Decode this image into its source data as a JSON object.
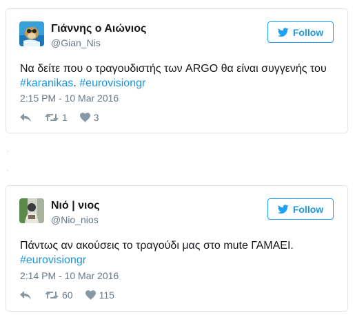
{
  "tweets": [
    {
      "display_name": "Γιάννης ο Αιώνιος",
      "handle": "@Gian_Nis",
      "follow_label": "Follow",
      "text_line_1": "Να δείτε που ο τραγουδιστής των ARGO θα είναι συγγενής του",
      "hashtag_1": "#karanikas",
      "separator": ". ",
      "hashtag_2": "#eurovisiongr",
      "timestamp": "2:15 PM - 10 Mar 2016",
      "retweets": "1",
      "likes": "3"
    },
    {
      "display_name": "Νιό | νιος",
      "handle": "@Nio_nios",
      "follow_label": "Follow",
      "text_line_1": "Πάντως αν ακούσεις το τραγούδι μας στο mute ΓΑΜΑΕΙ.",
      "hashtag_1": "#eurovisiongr",
      "timestamp": "2:14 PM - 10 Mar 2016",
      "retweets": "60",
      "likes": "115"
    }
  ],
  "colors": {
    "twitter_blue": "#1da1f2",
    "link_blue": "#1b95e0",
    "text_dark": "#14171a",
    "text_gray": "#657786",
    "border": "#dfe3e7"
  },
  "icons": {
    "follow": "twitter-bird-icon",
    "reply": "reply-icon",
    "retweet": "retweet-icon",
    "like": "heart-icon"
  }
}
